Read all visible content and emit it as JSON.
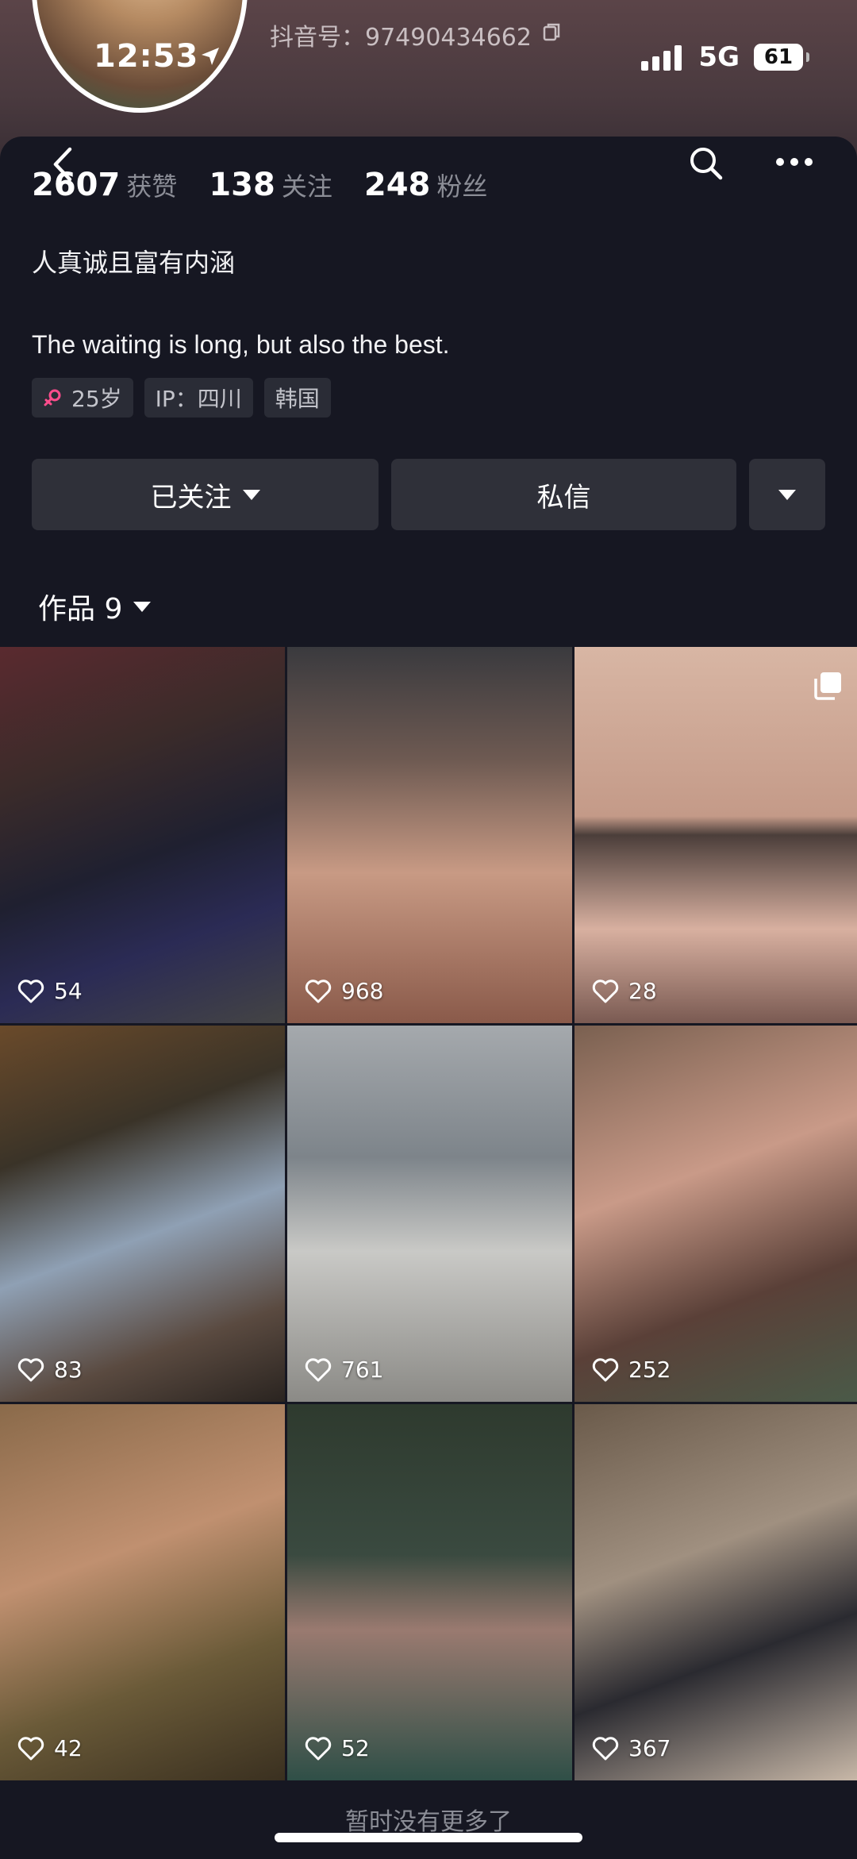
{
  "status_bar": {
    "time": "12:53",
    "network": "5G",
    "battery": "61"
  },
  "profile": {
    "douyin_id": "抖音号：97490434662",
    "stats": [
      {
        "num": "2607",
        "label": "获赞"
      },
      {
        "num": "138",
        "label": "关注"
      },
      {
        "num": "248",
        "label": "粉丝"
      }
    ],
    "bio_line1": "人真诚且富有内涵",
    "bio_line2": "The waiting is long, but also the best.",
    "tags": {
      "age": "25岁",
      "ip": "IP：四川",
      "region": "韩国"
    }
  },
  "actions": {
    "follow": "已关注",
    "message": "私信"
  },
  "works": {
    "label": "作品 9",
    "items": [
      {
        "likes": "54"
      },
      {
        "likes": "968"
      },
      {
        "likes": "28"
      },
      {
        "likes": "83"
      },
      {
        "likes": "761"
      },
      {
        "likes": "252"
      },
      {
        "likes": "42"
      },
      {
        "likes": "52"
      },
      {
        "likes": "367"
      }
    ]
  },
  "footer": {
    "no_more": "暂时没有更多了"
  }
}
